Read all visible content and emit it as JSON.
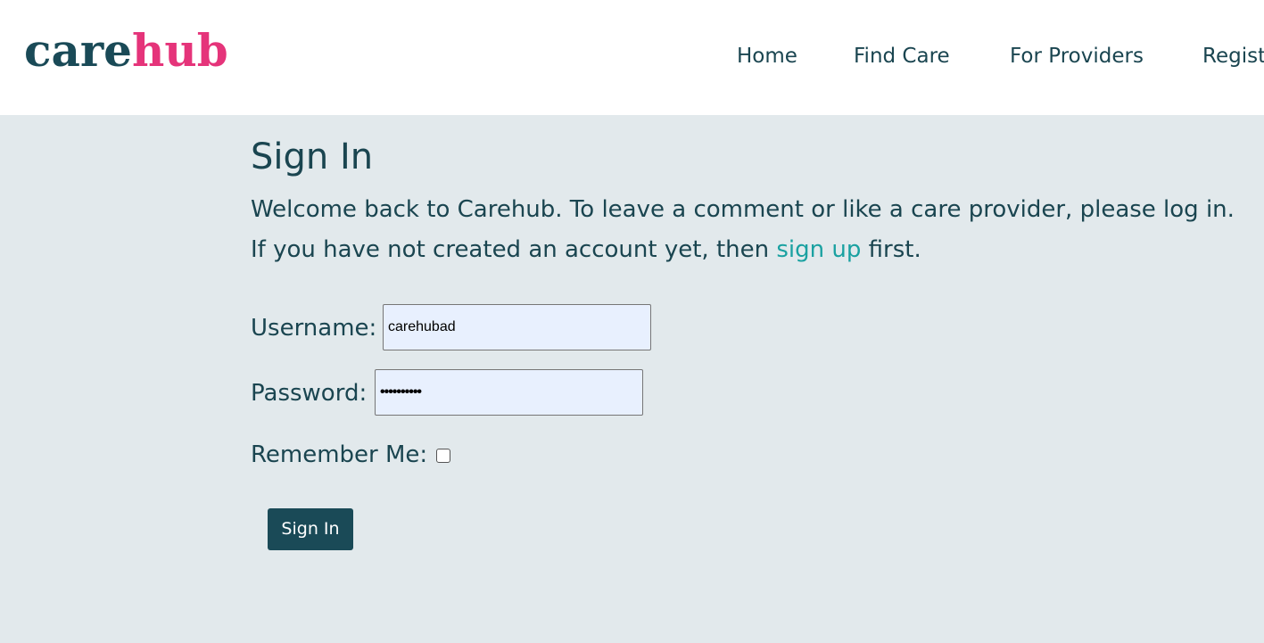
{
  "header": {
    "logo": {
      "part1": "care",
      "part2": "hub"
    },
    "nav": [
      {
        "label": "Home"
      },
      {
        "label": "Find Care"
      },
      {
        "label": "For Providers"
      },
      {
        "label": "Register"
      }
    ]
  },
  "main": {
    "title": "Sign In",
    "intro": {
      "before_link": "Welcome back to Carehub. To leave a comment or like a care provider, please log in. If you have not created an account yet, then ",
      "link_text": "sign up",
      "after_link": " first."
    },
    "form": {
      "username_label": "Username:",
      "username_value": "carehubad",
      "password_label": "Password:",
      "password_value": "••••••••••",
      "remember_label": "Remember Me:",
      "remember_checked": false,
      "submit_label": "Sign In"
    }
  },
  "colors": {
    "brand_dark": "#1a4a57",
    "brand_pink": "#e5347a",
    "link_teal": "#1aa1a1",
    "page_bg": "#e2e9ec",
    "input_bg": "#e8f0fe"
  }
}
